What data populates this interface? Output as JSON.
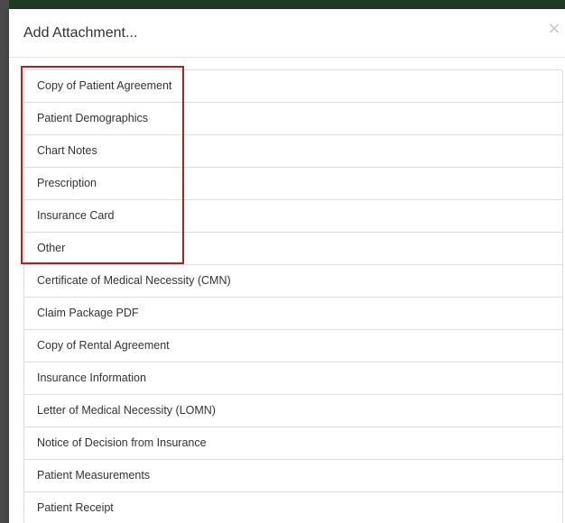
{
  "modal": {
    "title": "Add Attachment...",
    "close_label": "×"
  },
  "attachment_types": [
    {
      "label": "Copy of Patient Agreement"
    },
    {
      "label": "Patient Demographics"
    },
    {
      "label": "Chart Notes"
    },
    {
      "label": "Prescription"
    },
    {
      "label": "Insurance Card"
    },
    {
      "label": "Other"
    },
    {
      "label": "Certificate of Medical Necessity (CMN)"
    },
    {
      "label": "Claim Package PDF"
    },
    {
      "label": "Copy of Rental Agreement"
    },
    {
      "label": "Insurance Information"
    },
    {
      "label": "Letter of Medical Necessity (LOMN)"
    },
    {
      "label": "Notice of Decision from Insurance"
    },
    {
      "label": "Patient Measurements"
    },
    {
      "label": "Patient Receipt"
    }
  ],
  "colors": {
    "highlight": "#a4262c",
    "text": "#333333",
    "border": "#dddddd"
  }
}
